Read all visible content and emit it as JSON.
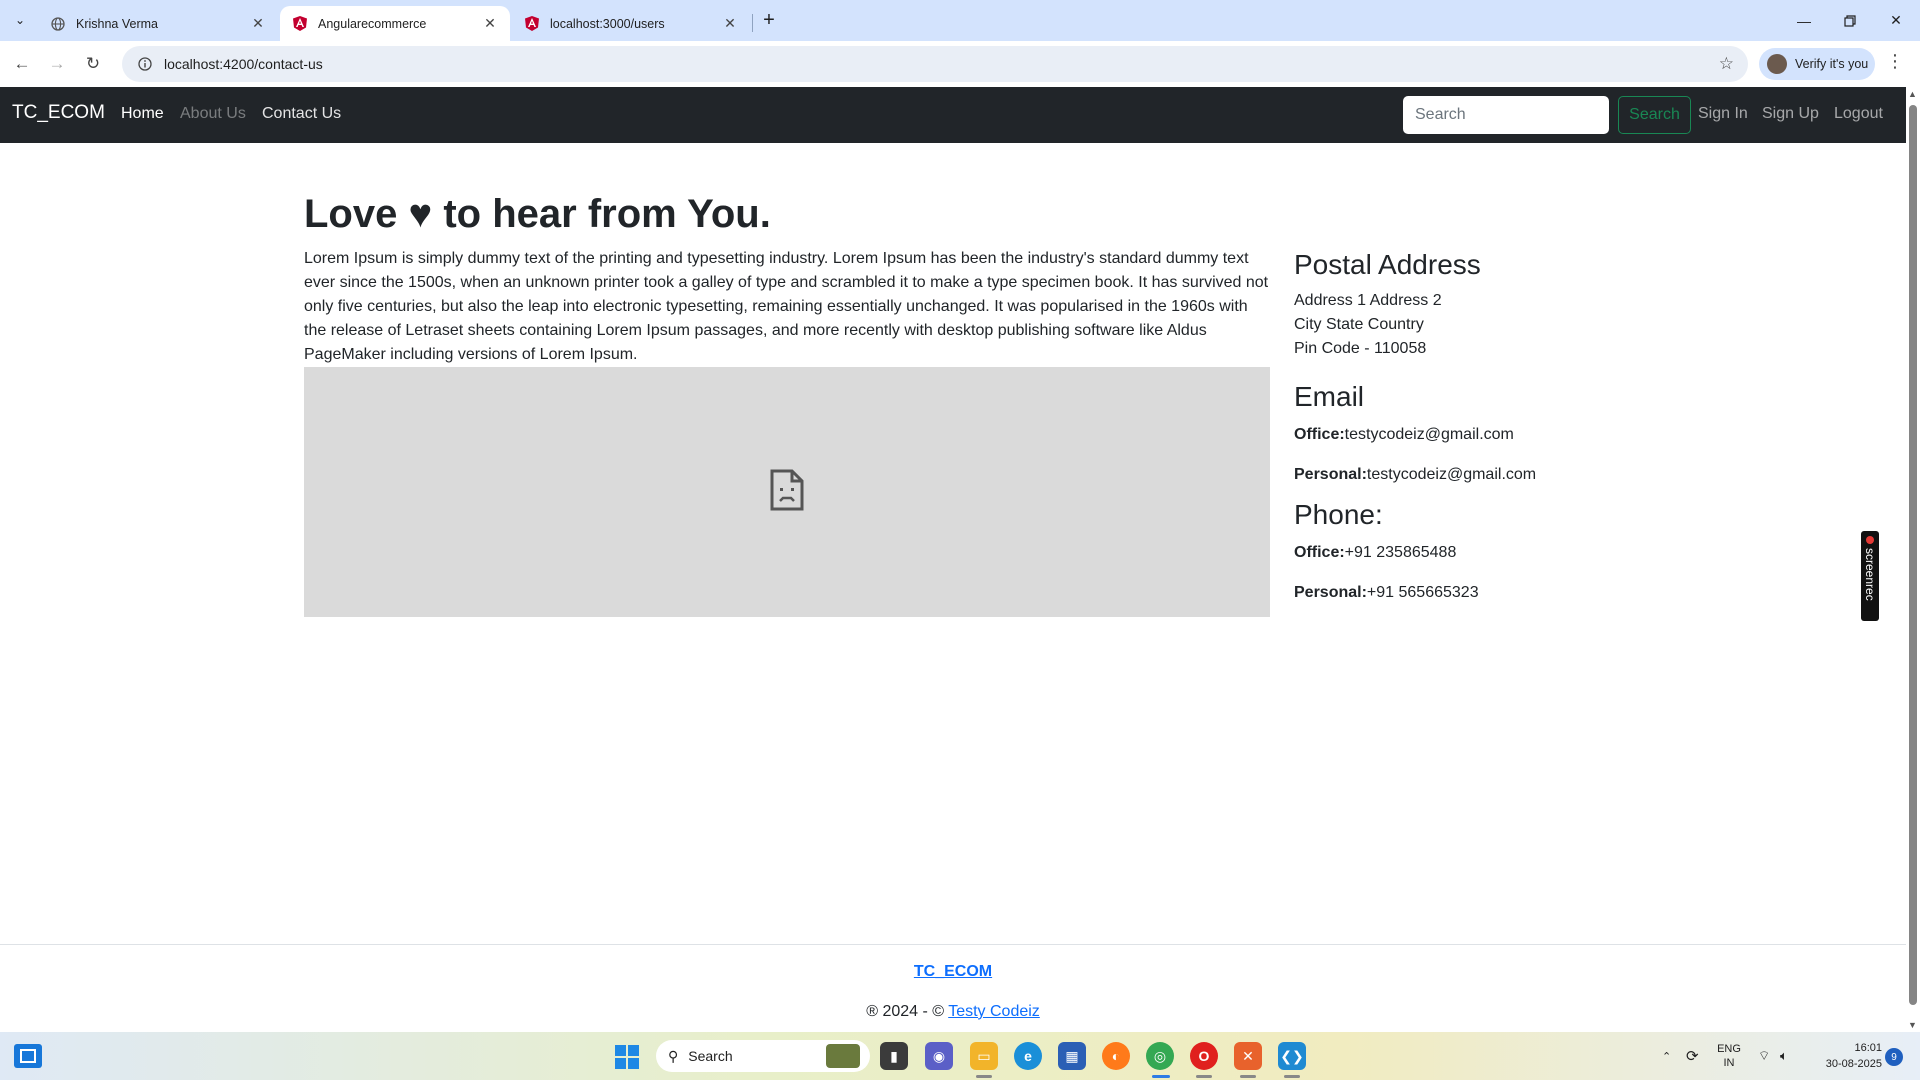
{
  "browser": {
    "tabs": [
      {
        "title": "Krishna Verma",
        "icon": "globe-icon"
      },
      {
        "title": "Angularecommerce",
        "icon": "angular-icon"
      },
      {
        "title": "localhost:3000/users",
        "icon": "angular-icon"
      }
    ],
    "url": "localhost:4200/contact-us",
    "verify_label": "Verify it's you"
  },
  "site": {
    "brand": "TC_ECOM",
    "nav": [
      "Home",
      "About Us",
      "Contact Us"
    ],
    "search_placeholder": "Search",
    "search_button": "Search",
    "auth": [
      "Sign In",
      "Sign Up",
      "Logout"
    ]
  },
  "contact": {
    "heading_pre": "Love",
    "heading_icon": "♥",
    "heading_post": "to hear from You.",
    "paragraph": "Lorem Ipsum is simply dummy text of the printing and typesetting industry. Lorem Ipsum has been the industry's standard dummy text ever since the 1500s, when an unknown printer took a galley of type and scrambled it to make a type specimen book. It has survived not only five centuries, but also the leap into electronic typesetting, remaining essentially unchanged. It was popularised in the 1960s with the release of Letraset sheets containing Lorem Ipsum passages, and more recently with desktop publishing software like Aldus PageMaker including versions of Lorem Ipsum.",
    "postal_title": "Postal Address",
    "address_lines": [
      "Address 1 Address 2",
      "City State Country",
      "Pin Code - 110058"
    ],
    "email_title": "Email",
    "email_office_label": "Office:",
    "email_office": "testycodeiz@gmail.com",
    "email_personal_label": "Personal:",
    "email_personal": "testycodeiz@gmail.com",
    "phone_title": "Phone:",
    "phone_office_label": "Office:",
    "phone_office": "+91 235865488",
    "phone_personal_label": "Personal:",
    "phone_personal": "+91 565665323"
  },
  "screenrec_label": "screenrec",
  "footer": {
    "brand_link": "TC_ECOM",
    "copy_prefix": "® 2024 - ©",
    "copy_link": "Testy Codeiz"
  },
  "taskbar": {
    "search_label": "Search",
    "lang_top": "ENG",
    "lang_bottom": "IN",
    "time": "16:01",
    "date": "30-08-2025",
    "notification_count": "9"
  },
  "colors": {
    "navbar_bg": "#212529",
    "success": "#198754",
    "link": "#0d6efd",
    "tab_strip": "#d3e3fd"
  }
}
